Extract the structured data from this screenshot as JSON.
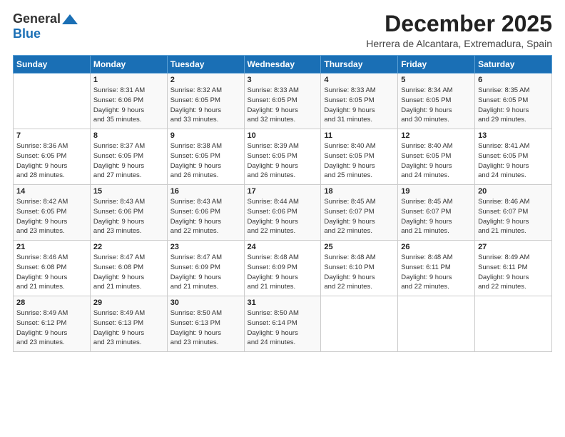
{
  "logo": {
    "general": "General",
    "blue": "Blue",
    "icon": "▶"
  },
  "title": "December 2025",
  "subtitle": "Herrera de Alcantara, Extremadura, Spain",
  "headers": [
    "Sunday",
    "Monday",
    "Tuesday",
    "Wednesday",
    "Thursday",
    "Friday",
    "Saturday"
  ],
  "weeks": [
    [
      {
        "day": "",
        "sunrise": "",
        "sunset": "",
        "daylight": ""
      },
      {
        "day": "1",
        "sunrise": "Sunrise: 8:31 AM",
        "sunset": "Sunset: 6:06 PM",
        "daylight": "Daylight: 9 hours and 35 minutes."
      },
      {
        "day": "2",
        "sunrise": "Sunrise: 8:32 AM",
        "sunset": "Sunset: 6:05 PM",
        "daylight": "Daylight: 9 hours and 33 minutes."
      },
      {
        "day": "3",
        "sunrise": "Sunrise: 8:33 AM",
        "sunset": "Sunset: 6:05 PM",
        "daylight": "Daylight: 9 hours and 32 minutes."
      },
      {
        "day": "4",
        "sunrise": "Sunrise: 8:33 AM",
        "sunset": "Sunset: 6:05 PM",
        "daylight": "Daylight: 9 hours and 31 minutes."
      },
      {
        "day": "5",
        "sunrise": "Sunrise: 8:34 AM",
        "sunset": "Sunset: 6:05 PM",
        "daylight": "Daylight: 9 hours and 30 minutes."
      },
      {
        "day": "6",
        "sunrise": "Sunrise: 8:35 AM",
        "sunset": "Sunset: 6:05 PM",
        "daylight": "Daylight: 9 hours and 29 minutes."
      }
    ],
    [
      {
        "day": "7",
        "sunrise": "Sunrise: 8:36 AM",
        "sunset": "Sunset: 6:05 PM",
        "daylight": "Daylight: 9 hours and 28 minutes."
      },
      {
        "day": "8",
        "sunrise": "Sunrise: 8:37 AM",
        "sunset": "Sunset: 6:05 PM",
        "daylight": "Daylight: 9 hours and 27 minutes."
      },
      {
        "day": "9",
        "sunrise": "Sunrise: 8:38 AM",
        "sunset": "Sunset: 6:05 PM",
        "daylight": "Daylight: 9 hours and 26 minutes."
      },
      {
        "day": "10",
        "sunrise": "Sunrise: 8:39 AM",
        "sunset": "Sunset: 6:05 PM",
        "daylight": "Daylight: 9 hours and 26 minutes."
      },
      {
        "day": "11",
        "sunrise": "Sunrise: 8:40 AM",
        "sunset": "Sunset: 6:05 PM",
        "daylight": "Daylight: 9 hours and 25 minutes."
      },
      {
        "day": "12",
        "sunrise": "Sunrise: 8:40 AM",
        "sunset": "Sunset: 6:05 PM",
        "daylight": "Daylight: 9 hours and 24 minutes."
      },
      {
        "day": "13",
        "sunrise": "Sunrise: 8:41 AM",
        "sunset": "Sunset: 6:05 PM",
        "daylight": "Daylight: 9 hours and 24 minutes."
      }
    ],
    [
      {
        "day": "14",
        "sunrise": "Sunrise: 8:42 AM",
        "sunset": "Sunset: 6:05 PM",
        "daylight": "Daylight: 9 hours and 23 minutes."
      },
      {
        "day": "15",
        "sunrise": "Sunrise: 8:43 AM",
        "sunset": "Sunset: 6:06 PM",
        "daylight": "Daylight: 9 hours and 23 minutes."
      },
      {
        "day": "16",
        "sunrise": "Sunrise: 8:43 AM",
        "sunset": "Sunset: 6:06 PM",
        "daylight": "Daylight: 9 hours and 22 minutes."
      },
      {
        "day": "17",
        "sunrise": "Sunrise: 8:44 AM",
        "sunset": "Sunset: 6:06 PM",
        "daylight": "Daylight: 9 hours and 22 minutes."
      },
      {
        "day": "18",
        "sunrise": "Sunrise: 8:45 AM",
        "sunset": "Sunset: 6:07 PM",
        "daylight": "Daylight: 9 hours and 22 minutes."
      },
      {
        "day": "19",
        "sunrise": "Sunrise: 8:45 AM",
        "sunset": "Sunset: 6:07 PM",
        "daylight": "Daylight: 9 hours and 21 minutes."
      },
      {
        "day": "20",
        "sunrise": "Sunrise: 8:46 AM",
        "sunset": "Sunset: 6:07 PM",
        "daylight": "Daylight: 9 hours and 21 minutes."
      }
    ],
    [
      {
        "day": "21",
        "sunrise": "Sunrise: 8:46 AM",
        "sunset": "Sunset: 6:08 PM",
        "daylight": "Daylight: 9 hours and 21 minutes."
      },
      {
        "day": "22",
        "sunrise": "Sunrise: 8:47 AM",
        "sunset": "Sunset: 6:08 PM",
        "daylight": "Daylight: 9 hours and 21 minutes."
      },
      {
        "day": "23",
        "sunrise": "Sunrise: 8:47 AM",
        "sunset": "Sunset: 6:09 PM",
        "daylight": "Daylight: 9 hours and 21 minutes."
      },
      {
        "day": "24",
        "sunrise": "Sunrise: 8:48 AM",
        "sunset": "Sunset: 6:09 PM",
        "daylight": "Daylight: 9 hours and 21 minutes."
      },
      {
        "day": "25",
        "sunrise": "Sunrise: 8:48 AM",
        "sunset": "Sunset: 6:10 PM",
        "daylight": "Daylight: 9 hours and 22 minutes."
      },
      {
        "day": "26",
        "sunrise": "Sunrise: 8:48 AM",
        "sunset": "Sunset: 6:11 PM",
        "daylight": "Daylight: 9 hours and 22 minutes."
      },
      {
        "day": "27",
        "sunrise": "Sunrise: 8:49 AM",
        "sunset": "Sunset: 6:11 PM",
        "daylight": "Daylight: 9 hours and 22 minutes."
      }
    ],
    [
      {
        "day": "28",
        "sunrise": "Sunrise: 8:49 AM",
        "sunset": "Sunset: 6:12 PM",
        "daylight": "Daylight: 9 hours and 23 minutes."
      },
      {
        "day": "29",
        "sunrise": "Sunrise: 8:49 AM",
        "sunset": "Sunset: 6:13 PM",
        "daylight": "Daylight: 9 hours and 23 minutes."
      },
      {
        "day": "30",
        "sunrise": "Sunrise: 8:50 AM",
        "sunset": "Sunset: 6:13 PM",
        "daylight": "Daylight: 9 hours and 23 minutes."
      },
      {
        "day": "31",
        "sunrise": "Sunrise: 8:50 AM",
        "sunset": "Sunset: 6:14 PM",
        "daylight": "Daylight: 9 hours and 24 minutes."
      },
      {
        "day": "",
        "sunrise": "",
        "sunset": "",
        "daylight": ""
      },
      {
        "day": "",
        "sunrise": "",
        "sunset": "",
        "daylight": ""
      },
      {
        "day": "",
        "sunrise": "",
        "sunset": "",
        "daylight": ""
      }
    ]
  ]
}
